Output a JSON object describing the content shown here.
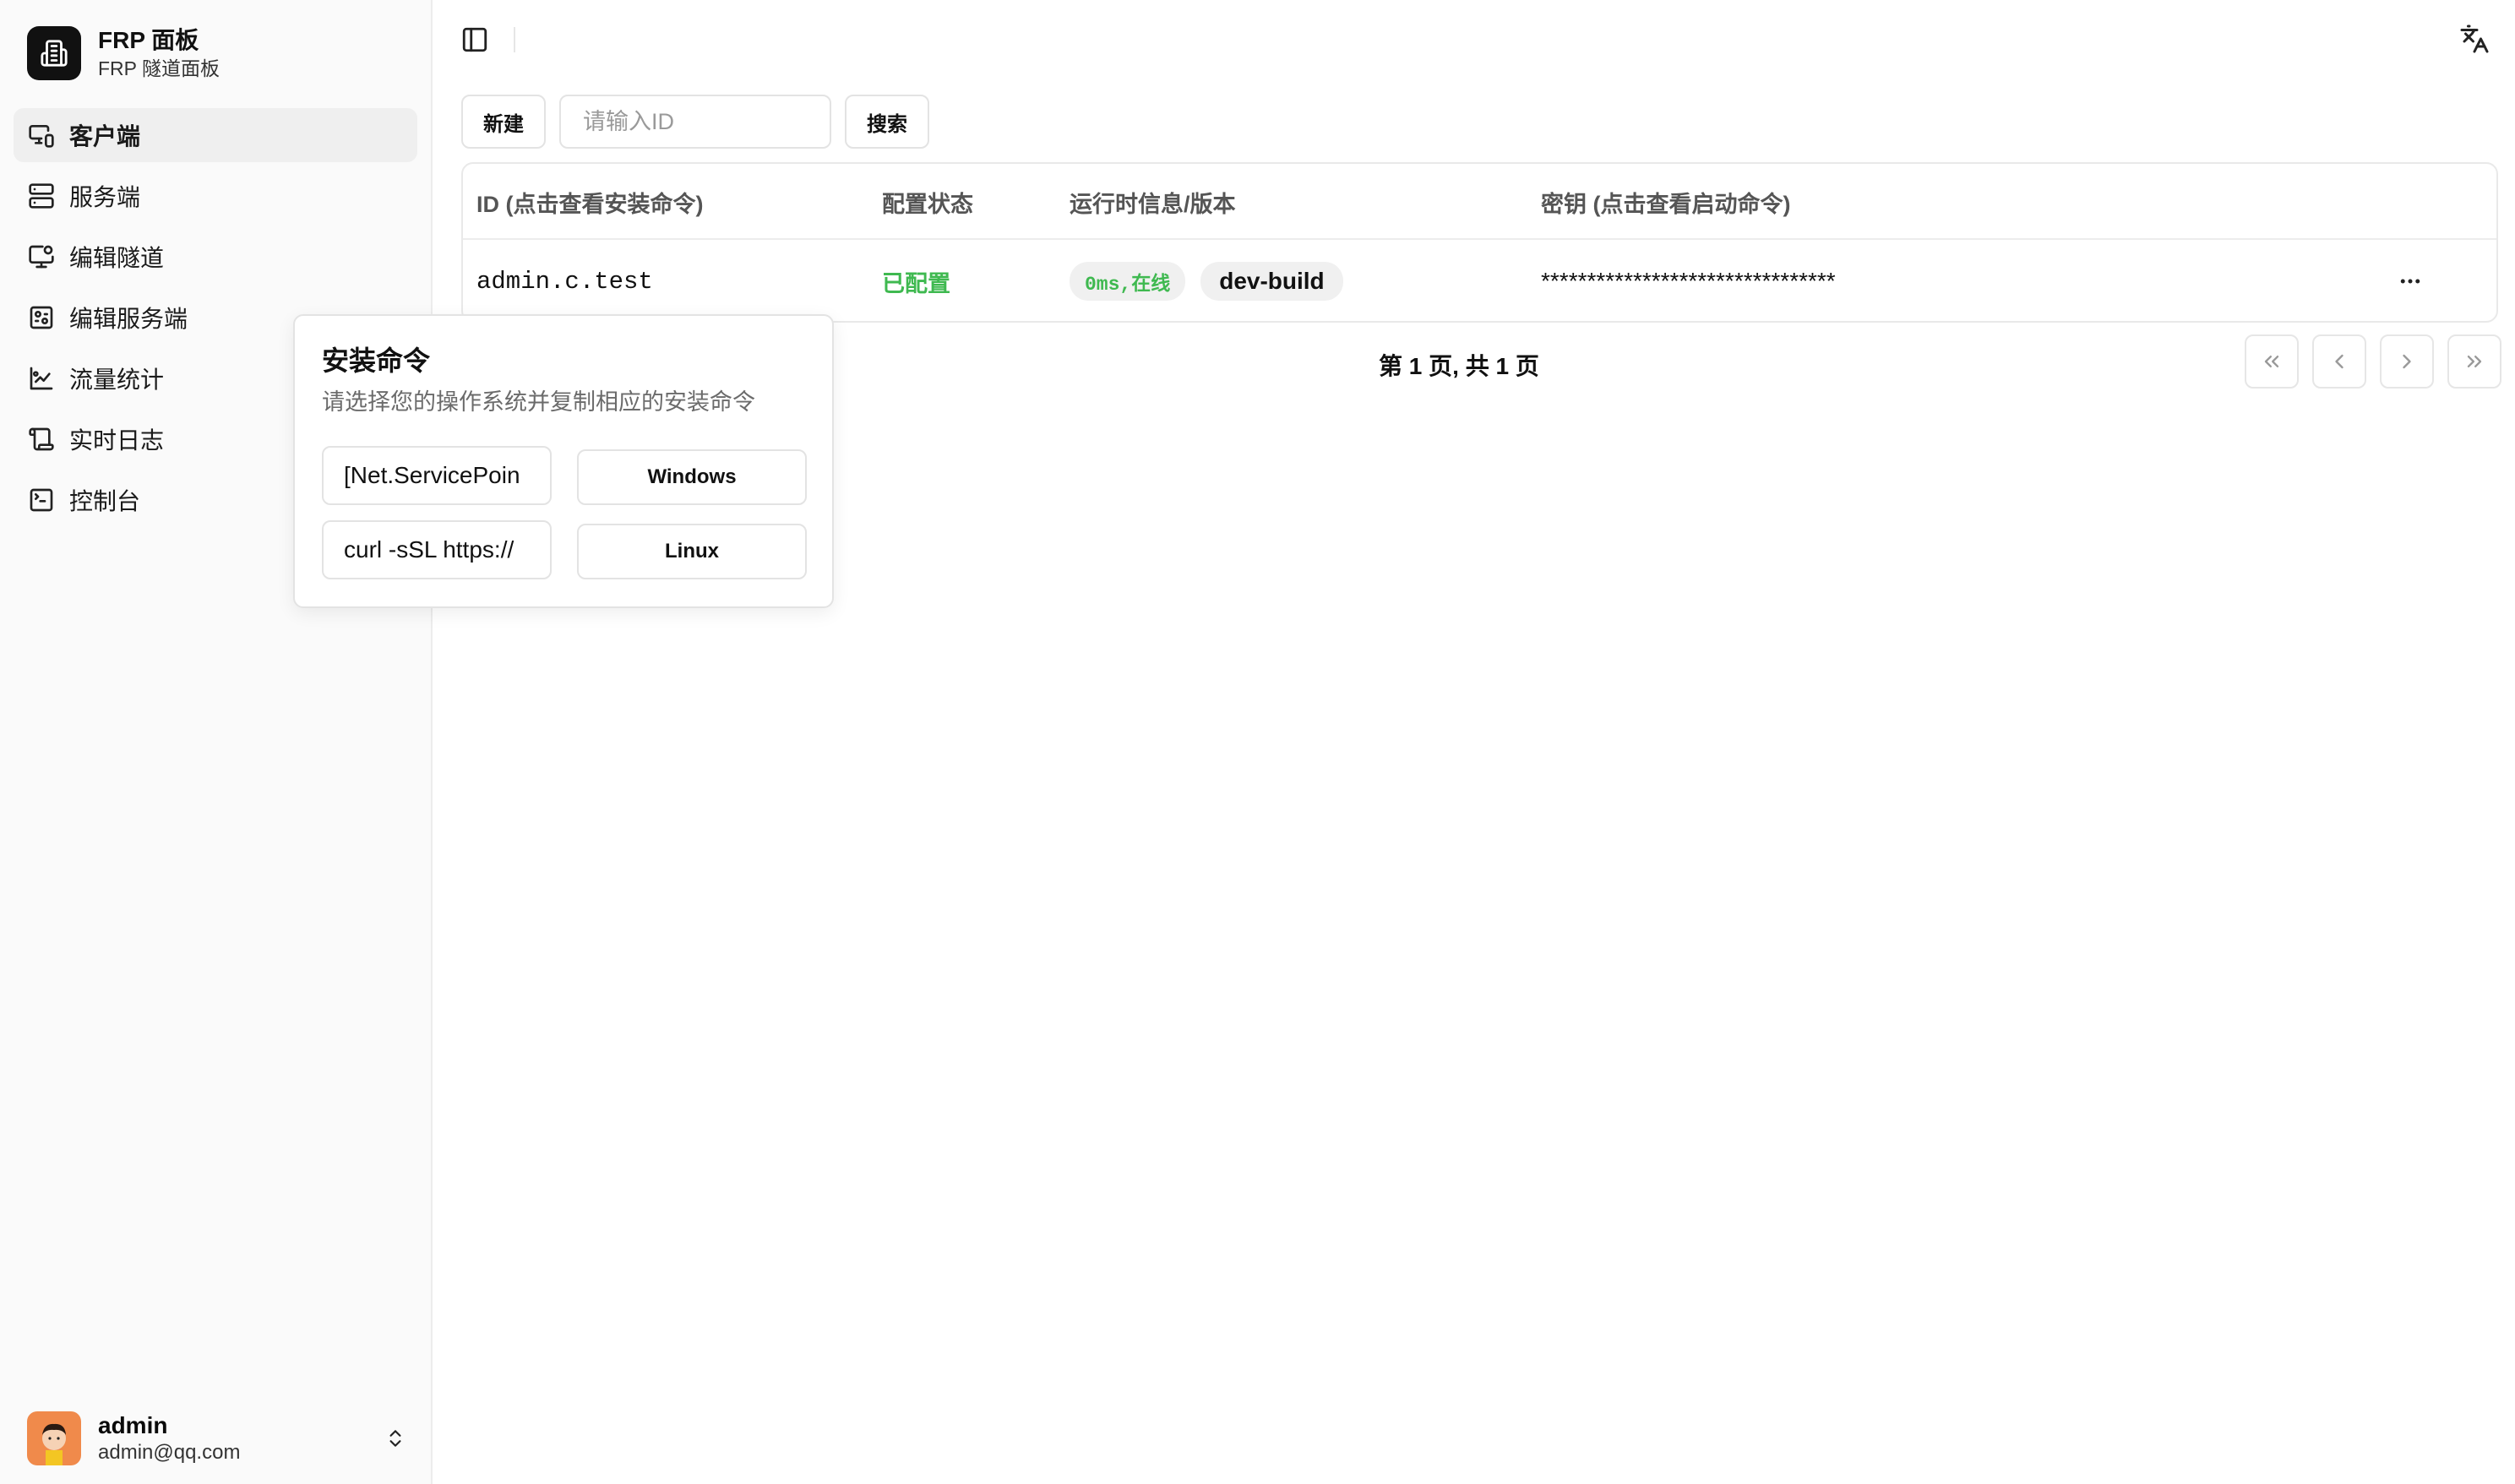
{
  "brand": {
    "title": "FRP 面板",
    "subtitle": "FRP 隧道面板"
  },
  "sidebar": {
    "items": [
      {
        "label": "客户端",
        "icon": "monitor-icon",
        "active": true
      },
      {
        "label": "服务端",
        "icon": "server-icon"
      },
      {
        "label": "编辑隧道",
        "icon": "tunnel-edit-icon"
      },
      {
        "label": "编辑服务端",
        "icon": "server-edit-icon"
      },
      {
        "label": "流量统计",
        "icon": "chart-icon"
      },
      {
        "label": "实时日志",
        "icon": "scroll-icon"
      },
      {
        "label": "控制台",
        "icon": "terminal-icon"
      }
    ]
  },
  "user": {
    "name": "admin",
    "email": "admin@qq.com"
  },
  "toolbar": {
    "new_label": "新建",
    "search_placeholder": "请输入ID",
    "search_label": "搜索"
  },
  "table": {
    "headers": [
      "ID (点击查看安装命令)",
      "配置状态",
      "运行时信息/版本",
      "密钥 (点击查看启动命令)"
    ],
    "rows": [
      {
        "id": "admin.c.test",
        "status": "已配置",
        "runtime": "0ms,在线",
        "version": "dev-build",
        "secret": "********************************"
      }
    ]
  },
  "pagination": {
    "text": "第 1 页, 共 1 页"
  },
  "popover": {
    "title": "安装命令",
    "description": "请选择您的操作系统并复制相应的安装命令",
    "windows_cmd": "[Net.ServicePoin",
    "windows_label": "Windows",
    "linux_cmd": "curl -sSL https://",
    "linux_label": "Linux"
  },
  "colors": {
    "accent": "#111111",
    "online_green": "#3fb950",
    "sidebar_bg": "#fafafa"
  }
}
